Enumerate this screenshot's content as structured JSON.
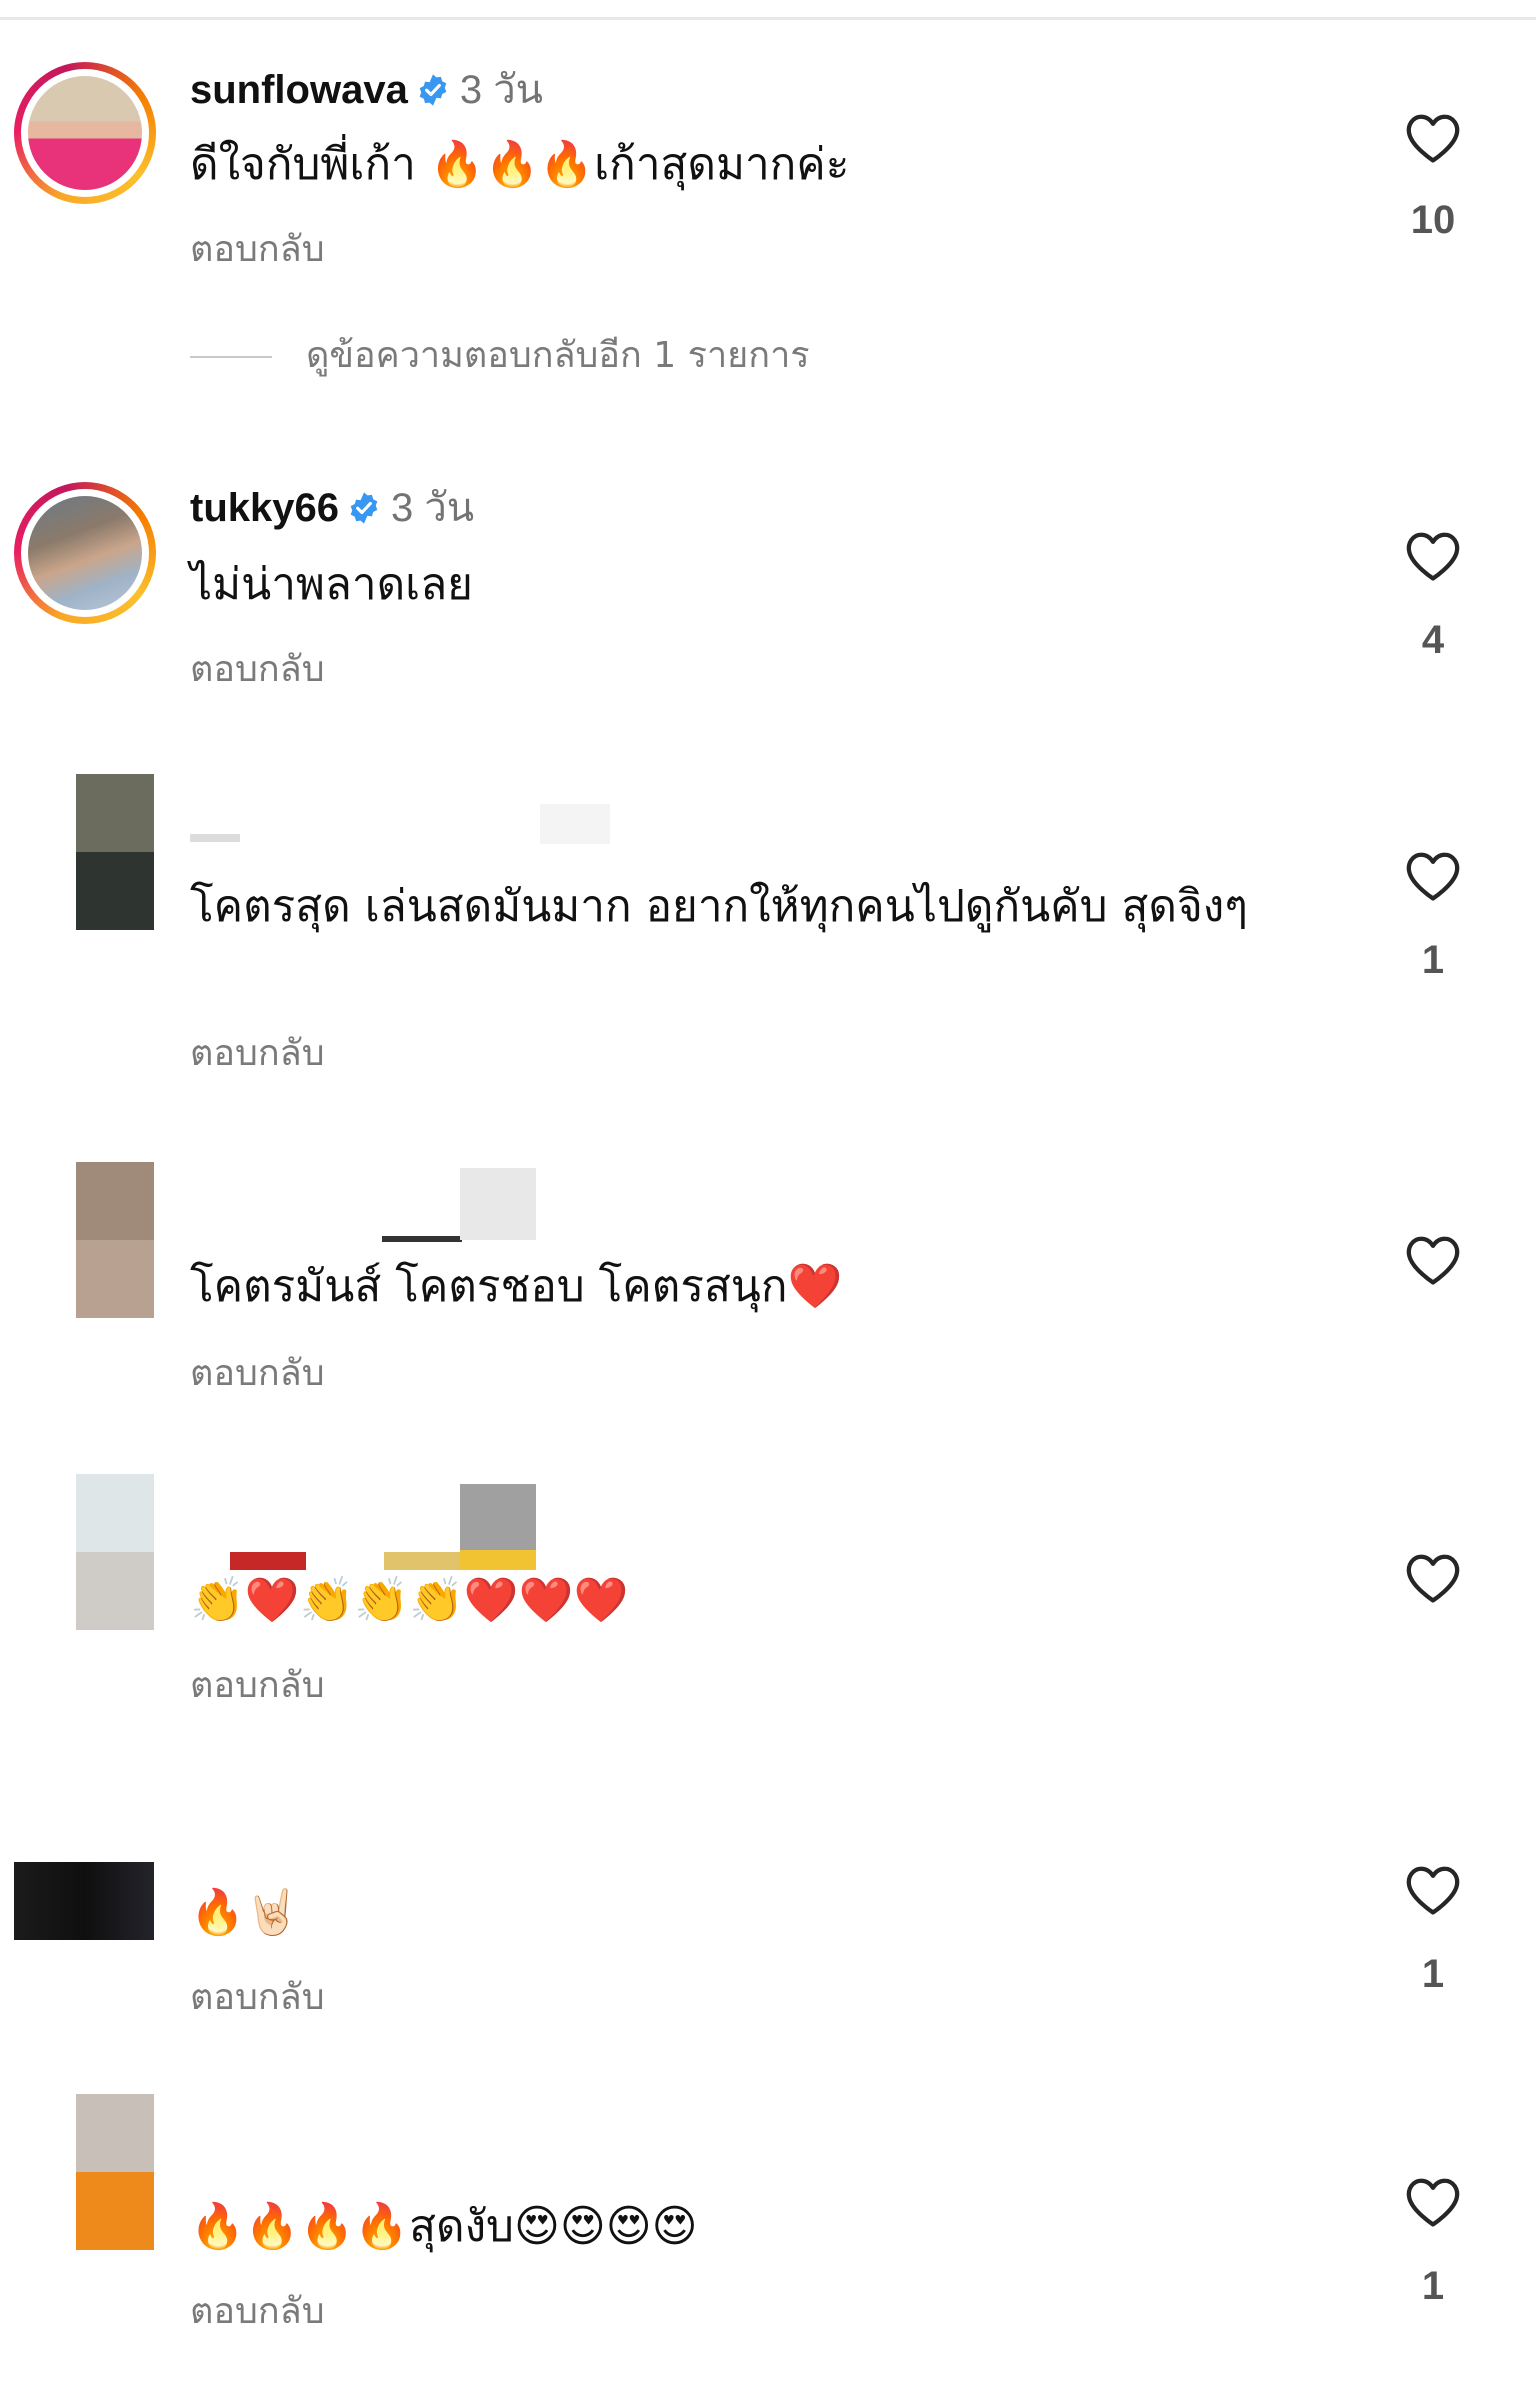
{
  "comments": [
    {
      "handle": "sunflowava",
      "verified": true,
      "age": "3 วัน",
      "text": "ดีใจกับพี่เก้า 🔥🔥🔥เก้าสุดมากค่ะ",
      "reply_label": "ตอบกลับ",
      "like_count": "10",
      "view_replies": "ดูข้อความตอบกลับอีก 1 รายการ"
    },
    {
      "handle": "tukky66",
      "verified": true,
      "age": "3 วัน",
      "text": "ไม่น่าพลาดเลย",
      "reply_label": "ตอบกลับ",
      "like_count": "4"
    },
    {
      "text": "โคตรสุด เล่นสดมันมาก อยากให้ทุกคนไปดูกันคับ สุดจิงๆ",
      "reply_label": "ตอบกลับ",
      "like_count": "1"
    },
    {
      "text": "โคตรมันส์ โคตรชอบ โคตรสนุก❤️",
      "reply_label": "ตอบกลับ",
      "like_count": ""
    },
    {
      "text": "👏❤️👏👏👏❤️❤️❤️",
      "reply_label": "ตอบกลับ",
      "like_count": ""
    },
    {
      "text": "🔥🤘🏻",
      "reply_label": "ตอบกลับ",
      "like_count": "1"
    },
    {
      "text": "🔥🔥🔥🔥สุดงับ😍😍😍😍",
      "reply_label": "ตอบกลับ",
      "like_count": "1"
    }
  ],
  "icons": {
    "like": "heart-outline-icon",
    "verified": "verified-badge-icon"
  },
  "colors": {
    "verified": "#3897f0",
    "secondary_text": "#737373"
  }
}
